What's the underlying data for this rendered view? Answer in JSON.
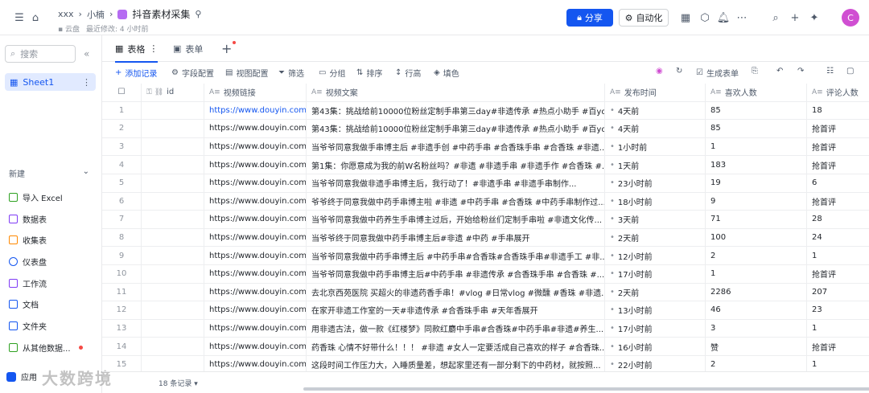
{
  "topbar": {
    "breadcrumb": [
      "xxx",
      "小楠"
    ],
    "doc_title": "抖音素材采集",
    "location": "云盘",
    "last_modified": "最近修改: 4 小时前",
    "share_label": "分享",
    "automation_label": "自动化",
    "avatar_letter": "C",
    "accent_color": "#1456f0"
  },
  "sidebar": {
    "search_placeholder": "搜索",
    "sheet_name": "Sheet1",
    "new_label": "新建",
    "items": [
      {
        "label": "导入 Excel",
        "color": "#2ea121"
      },
      {
        "label": "数据表",
        "color": "#7f3bf5"
      },
      {
        "label": "收集表",
        "color": "#ff8800"
      },
      {
        "label": "仪表盘",
        "color": "#1456f0"
      },
      {
        "label": "工作流",
        "color": "#7f3bf5"
      },
      {
        "label": "文档",
        "color": "#1456f0"
      },
      {
        "label": "文件夹",
        "color": "#1456f0"
      },
      {
        "label": "从其他数据...",
        "color": "#2ea121"
      }
    ],
    "bottom_label": "应用",
    "watermark": "大数跨境"
  },
  "tabs": [
    {
      "label": "表格",
      "active": true
    },
    {
      "label": "表单",
      "active": false
    }
  ],
  "toolbar": {
    "add_record": "添加记录",
    "field_config": "字段配置",
    "view_config": "视图配置",
    "filter": "筛选",
    "group": "分组",
    "sort": "排序",
    "row_height": "行高",
    "fill_color": "填色",
    "generate_form": "生成表单"
  },
  "table": {
    "columns": [
      "id",
      "视频链接",
      "视频文案",
      "发布时间",
      "喜欢人数",
      "评论人数"
    ],
    "rows": [
      {
        "n": "1",
        "link": "https://www.douyin.com...",
        "text": "第43集：挑战给前10000位粉丝定制手串第三day#非遗传承 #热点小助手 #百yo...",
        "time": "4天前",
        "likes": "85",
        "comments": "18"
      },
      {
        "n": "2",
        "link": "https://www.douyin.com...",
        "text": "第43集：挑战给前10000位粉丝定制手串第三day#非遗传承 #热点小助手 #百yo...",
        "time": "4天前",
        "likes": "85",
        "comments": "抢首评"
      },
      {
        "n": "3",
        "link": "https://www.douyin.com...",
        "text": "当爷爷同意我做手串博主后 #非遗手创 #中药手串 #合香珠手串 #合香珠 #非遗...",
        "time": "1小时前",
        "likes": "1",
        "comments": "抢首评"
      },
      {
        "n": "4",
        "link": "https://www.douyin.com...",
        "text": "第1集：你愿意成为我的前W名粉丝吗？#非遗 #非遗手串 #非遗手作 #合香珠 #...",
        "time": "1天前",
        "likes": "183",
        "comments": "抢首评"
      },
      {
        "n": "5",
        "link": "https://www.douyin.com...",
        "text": "当爷爷同意我做非遗手串博主后，我行动了！#非遗手串 #非遗手串制作...",
        "time": "23小时前",
        "likes": "19",
        "comments": "6"
      },
      {
        "n": "6",
        "link": "https://www.douyin.com...",
        "text": "爷爷终于同意我做中药手串博主啦 #非遗 #中药手串 #合香珠 #中药手串制作过...",
        "time": "18小时前",
        "likes": "9",
        "comments": "抢首评"
      },
      {
        "n": "7",
        "link": "https://www.douyin.com...",
        "text": "当爷爷同意我做中药养生手串博主过后，开始给粉丝们定制手串啦 #非遗文化传...",
        "time": "3天前",
        "likes": "71",
        "comments": "28"
      },
      {
        "n": "8",
        "link": "https://www.douyin.com...",
        "text": "当爷爷终于同意我做中药手串博主后#非遗 #中药 #手串展开",
        "time": "2天前",
        "likes": "100",
        "comments": "24"
      },
      {
        "n": "9",
        "link": "https://www.douyin.com...",
        "text": "当爷爷同意我做中药手串博主后 #中药手串#合香珠#合香珠手串#非遗手工 #非...",
        "time": "12小时前",
        "likes": "2",
        "comments": "1"
      },
      {
        "n": "10",
        "link": "https://www.douyin.com...",
        "text": "当爷爷同意我做中药手串博主后#中药手串 #非遗传承 #合香珠手串 #合香珠 #...",
        "time": "17小时前",
        "likes": "1",
        "comments": "抢首评"
      },
      {
        "n": "11",
        "link": "https://www.douyin.com...",
        "text": "去北京西苑医院 买超火的非遗药香手串！#vlog #日常vlog #微醺 #香珠 #非遗...",
        "time": "2天前",
        "likes": "2286",
        "comments": "207"
      },
      {
        "n": "12",
        "link": "https://www.douyin.com...",
        "text": "在家开非遗工作室的一天#非遗传承 #合香珠手串 #天年香展开",
        "time": "13小时前",
        "likes": "46",
        "comments": "23"
      },
      {
        "n": "13",
        "link": "https://www.douyin.com...",
        "text": "用非遗古法，做一款《红楼梦》同款红麝中手串#合香珠#中药手串#非遗#养生...",
        "time": "17小时前",
        "likes": "3",
        "comments": "1"
      },
      {
        "n": "14",
        "link": "https://www.douyin.com...",
        "text": "药香珠 心情不好带什么！！！ #非遗 #女人一定要活成自己喜欢的样子 #合香珠...",
        "time": "16小时前",
        "likes": "赞",
        "comments": "抢首评"
      },
      {
        "n": "15",
        "link": "https://www.douyin.com...",
        "text": "这段时间工作压力大，入睡质量差，想起家里还有一部分剩下的中药材，就按照...",
        "time": "22小时前",
        "likes": "2",
        "comments": "1"
      }
    ],
    "record_count": "18 条记录"
  }
}
